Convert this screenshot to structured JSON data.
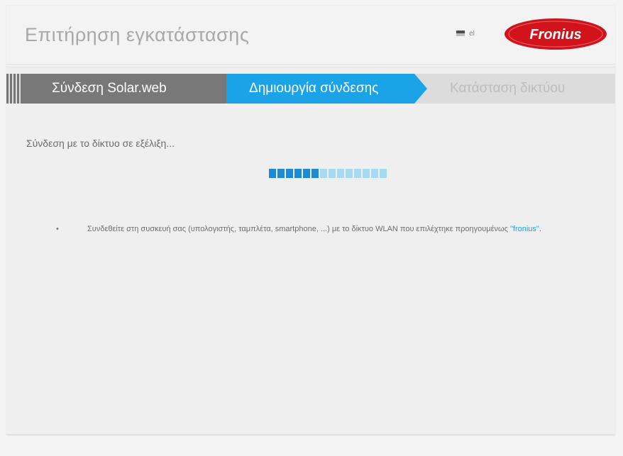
{
  "header": {
    "title": "Επιτήρηση εγκατάστασης",
    "language_code": "el",
    "logo_text": "Fronius",
    "logo_color": "#d2131b"
  },
  "steps": [
    {
      "label": "Σύνδεση Solar.web",
      "state": "completed",
      "color": "#787878"
    },
    {
      "label": "Δημιουργία σύνδεσης",
      "state": "active",
      "color": "#1aa3e6"
    },
    {
      "label": "Κατάσταση δικτύου",
      "state": "pending",
      "color": "#bdbdbd"
    }
  ],
  "main": {
    "status_text": "Σύνδεση με το δίκτυο σε εξέλιξη...",
    "progress": {
      "filled_segments": 6,
      "total_segments": 14
    },
    "note": {
      "bullet": "•",
      "text": "Συνδεθείτε στη συσκευή σας (υπολογιστής, ταμπλέτα, smartphone, ...) με το δίκτυο WLAN που επιλέχτηκε προηγουμένως ",
      "link_text": "\"fronius\"",
      "suffix": "."
    }
  },
  "icons": [
    "flag-icon",
    "fronius-logo"
  ]
}
